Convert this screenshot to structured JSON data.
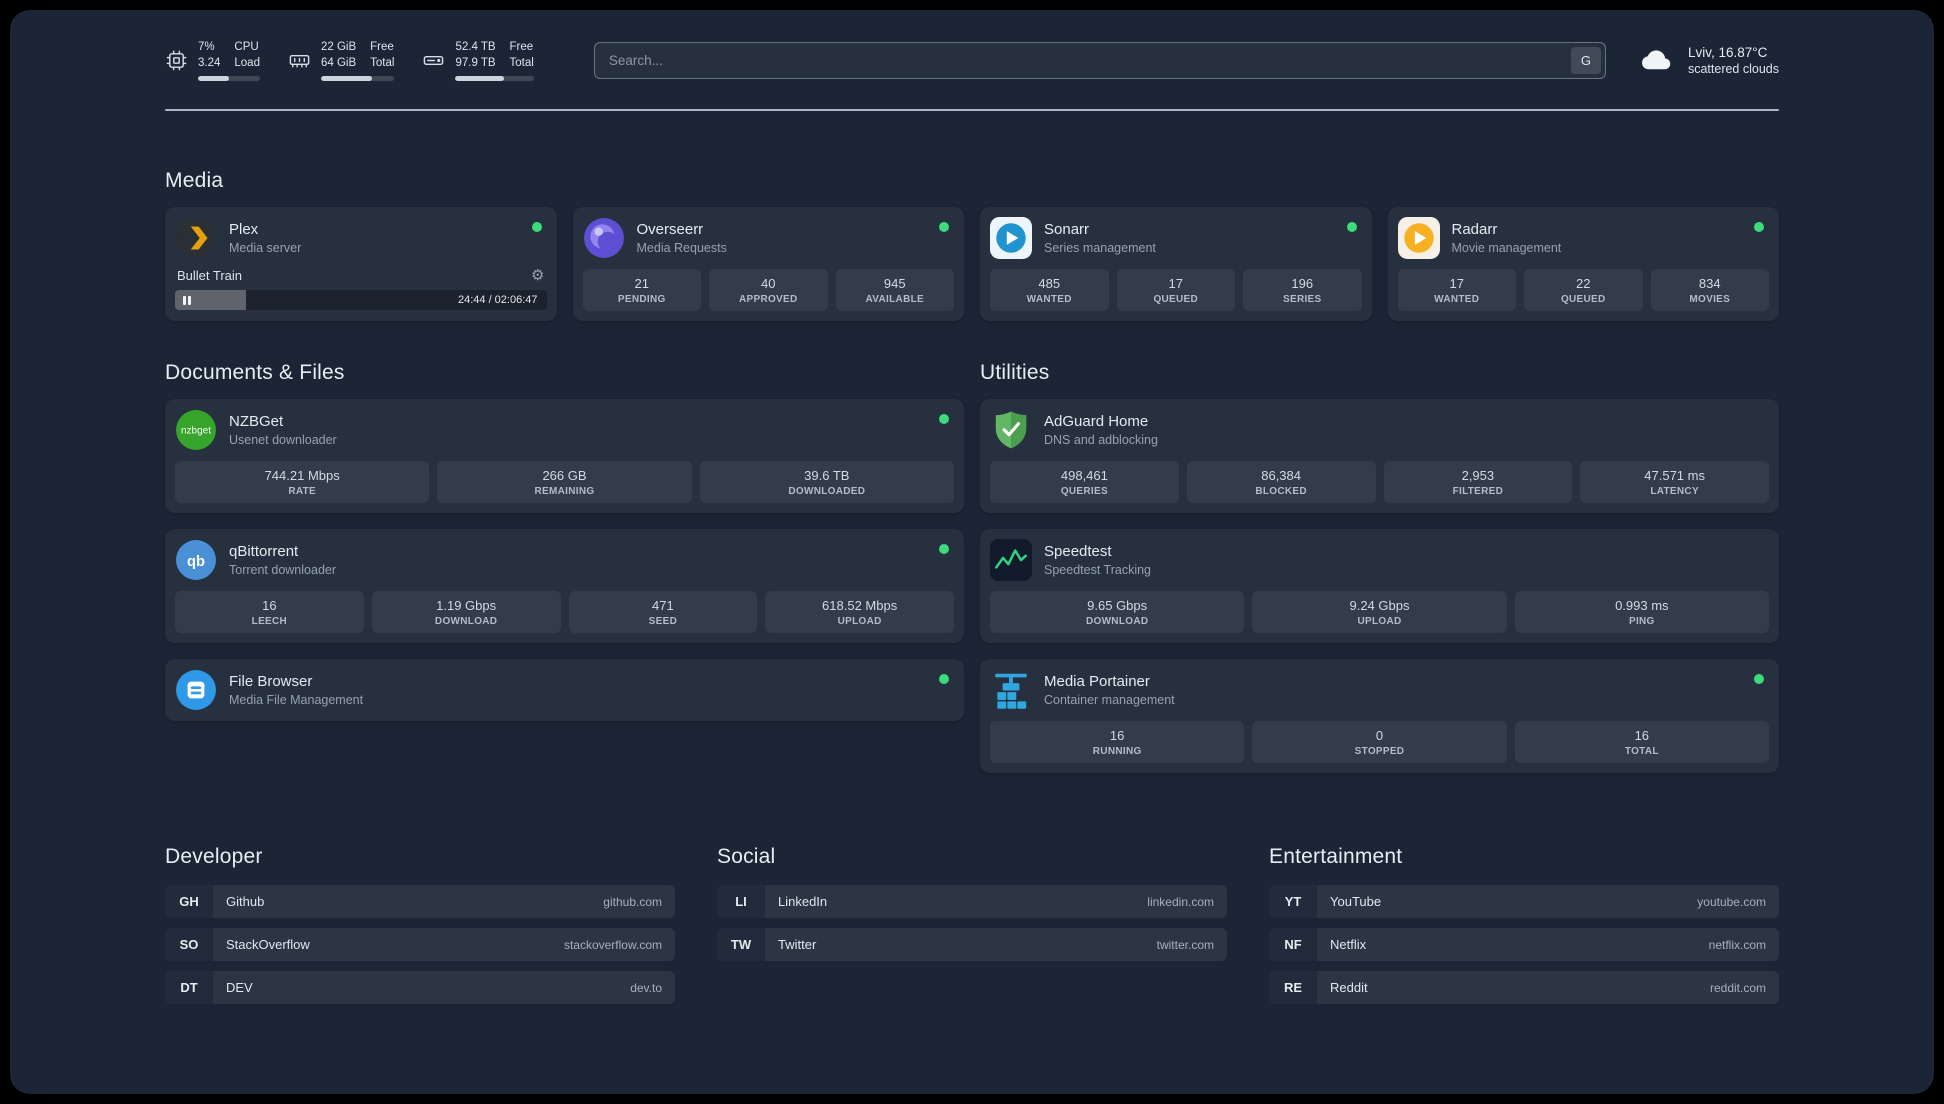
{
  "colors": {
    "background": "#1b2535",
    "status_online": "#3ddc7a",
    "plex_accent": "#e5a00d",
    "overseerr_accent": "#5d4fd3",
    "sonarr_accent": "#2193cf",
    "radarr_accent": "#f6b021",
    "nzbget_accent": "#36a52c",
    "qbittorrent_accent": "#4a90d6",
    "filebrowser_accent": "#2f99e8",
    "adguard_accent": "#63b663",
    "speedtest_accent": "#35d07f",
    "portainer_accent": "#2fa8e0"
  },
  "icons": {
    "gear": "⚙"
  },
  "topbar": {
    "cpu": {
      "value1": "7%",
      "value2": "3.24",
      "label1": "CPU",
      "label2": "Load"
    },
    "memory": {
      "value1": "22 GiB",
      "value2": "64 GiB",
      "label1": "Free",
      "label2": "Total"
    },
    "disk": {
      "value1": "52.4 TB",
      "value2": "97.9 TB",
      "label1": "Free",
      "label2": "Total"
    },
    "search": {
      "placeholder": "Search...",
      "button": "G"
    },
    "weather": {
      "location": "Lviv, 16.87°C",
      "condition": "scattered clouds"
    }
  },
  "sections": {
    "media": "Media",
    "documents": "Documents & Files",
    "utilities": "Utilities",
    "developer": "Developer",
    "social": "Social",
    "entertainment": "Entertainment"
  },
  "media": {
    "plex": {
      "title": "Plex",
      "subtitle": "Media server",
      "now_playing": "Bullet Train",
      "time": "24:44 / 02:06:47"
    },
    "overseerr": {
      "title": "Overseerr",
      "subtitle": "Media Requests",
      "stats": [
        {
          "value": "21",
          "label": "PENDING"
        },
        {
          "value": "40",
          "label": "APPROVED"
        },
        {
          "value": "945",
          "label": "AVAILABLE"
        }
      ]
    },
    "sonarr": {
      "title": "Sonarr",
      "subtitle": "Series management",
      "stats": [
        {
          "value": "485",
          "label": "WANTED"
        },
        {
          "value": "17",
          "label": "QUEUED"
        },
        {
          "value": "196",
          "label": "SERIES"
        }
      ]
    },
    "radarr": {
      "title": "Radarr",
      "subtitle": "Movie management",
      "stats": [
        {
          "value": "17",
          "label": "WANTED"
        },
        {
          "value": "22",
          "label": "QUEUED"
        },
        {
          "value": "834",
          "label": "MOVIES"
        }
      ]
    }
  },
  "documents": {
    "nzbget": {
      "title": "NZBGet",
      "subtitle": "Usenet downloader",
      "stats": [
        {
          "value": "744.21 Mbps",
          "label": "RATE"
        },
        {
          "value": "266 GB",
          "label": "REMAINING"
        },
        {
          "value": "39.6 TB",
          "label": "DOWNLOADED"
        }
      ]
    },
    "qbittorrent": {
      "title": "qBittorrent",
      "subtitle": "Torrent downloader",
      "stats": [
        {
          "value": "16",
          "label": "LEECH"
        },
        {
          "value": "1.19 Gbps",
          "label": "DOWNLOAD"
        },
        {
          "value": "471",
          "label": "SEED"
        },
        {
          "value": "618.52 Mbps",
          "label": "UPLOAD"
        }
      ]
    },
    "filebrowser": {
      "title": "File Browser",
      "subtitle": "Media File Management"
    }
  },
  "utilities": {
    "adguard": {
      "title": "AdGuard Home",
      "subtitle": "DNS and adblocking",
      "stats": [
        {
          "value": "498,461",
          "label": "QUERIES"
        },
        {
          "value": "86,384",
          "label": "BLOCKED"
        },
        {
          "value": "2,953",
          "label": "FILTERED"
        },
        {
          "value": "47.571 ms",
          "label": "LATENCY"
        }
      ]
    },
    "speedtest": {
      "title": "Speedtest",
      "subtitle": "Speedtest Tracking",
      "stats": [
        {
          "value": "9.65 Gbps",
          "label": "DOWNLOAD"
        },
        {
          "value": "9.24 Gbps",
          "label": "UPLOAD"
        },
        {
          "value": "0.993 ms",
          "label": "PING"
        }
      ]
    },
    "portainer": {
      "title": "Media Portainer",
      "subtitle": "Container management",
      "stats": [
        {
          "value": "16",
          "label": "RUNNING"
        },
        {
          "value": "0",
          "label": "STOPPED"
        },
        {
          "value": "16",
          "label": "TOTAL"
        }
      ]
    }
  },
  "bookmarks": {
    "developer": [
      {
        "abbr": "GH",
        "name": "Github",
        "domain": "github.com"
      },
      {
        "abbr": "SO",
        "name": "StackOverflow",
        "domain": "stackoverflow.com"
      },
      {
        "abbr": "DT",
        "name": "DEV",
        "domain": "dev.to"
      }
    ],
    "social": [
      {
        "abbr": "LI",
        "name": "LinkedIn",
        "domain": "linkedin.com"
      },
      {
        "abbr": "TW",
        "name": "Twitter",
        "domain": "twitter.com"
      }
    ],
    "entertainment": [
      {
        "abbr": "YT",
        "name": "YouTube",
        "domain": "youtube.com"
      },
      {
        "abbr": "NF",
        "name": "Netflix",
        "domain": "netflix.com"
      },
      {
        "abbr": "RE",
        "name": "Reddit",
        "domain": "reddit.com"
      }
    ]
  }
}
